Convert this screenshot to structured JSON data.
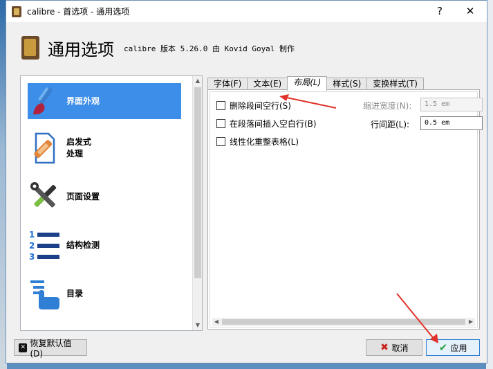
{
  "window": {
    "title": "calibre - 首选项 - 通用选项",
    "help_glyph": "?",
    "close_glyph": "✕"
  },
  "header": {
    "heading": "通用选项",
    "subheading": "calibre 版本 5.26.0 由 Kovid Goyal 制作"
  },
  "sidebar": {
    "items": [
      {
        "label": "界面外观",
        "icon": "paintbrush-icon",
        "selected": true
      },
      {
        "label": "启发式\n处理",
        "icon": "document-fix-icon",
        "selected": false
      },
      {
        "label": "页面设置",
        "icon": "tools-icon",
        "selected": false
      },
      {
        "label": "结构检测",
        "icon": "numbered-list-icon",
        "selected": false
      },
      {
        "label": "目录",
        "icon": "toc-hand-icon",
        "selected": false
      }
    ]
  },
  "tabs": [
    {
      "label": "字体(F)",
      "active": false
    },
    {
      "label": "文本(E)",
      "active": false
    },
    {
      "label": "布局(L)",
      "active": true
    },
    {
      "label": "样式(S)",
      "active": false
    },
    {
      "label": "变换样式(T)",
      "active": false
    }
  ],
  "layout_tab": {
    "remove_spacing_label": "删除段间空行(S)",
    "insert_blank_label": "在段落间插入空白行(B)",
    "linearize_tables_label": "线性化重整表格(L)",
    "indent_label": "缩进宽度(N):",
    "indent_value": "1.5 em",
    "line_spacing_label": "行间距(L):",
    "line_spacing_value": "0.5 em"
  },
  "buttons": {
    "restore_defaults": "恢复默认值(D)",
    "cancel": "取消",
    "apply": "应用"
  },
  "colors": {
    "selection": "#3d8ee8",
    "annotation_arrow": "#e0322a"
  }
}
